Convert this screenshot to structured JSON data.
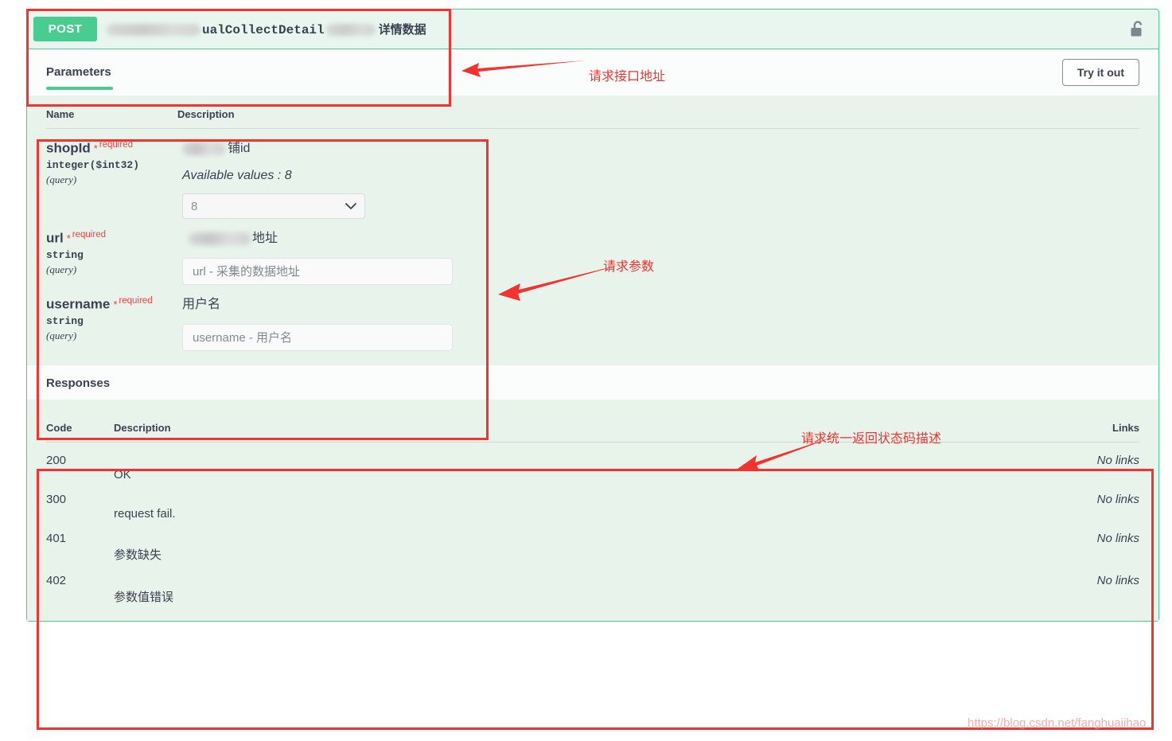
{
  "operation": {
    "method": "POST",
    "path_suffix": "ualCollectDetail",
    "summary_cn": "详情数据",
    "lock_icon": "unlocked-padlock-icon"
  },
  "tabs": {
    "parameters_label": "Parameters",
    "try_it_out_label": "Try it out"
  },
  "parameters_table": {
    "header": {
      "name": "Name",
      "description": "Description"
    },
    "rows": [
      {
        "name": "shopId",
        "required_star": "*",
        "required_word": "required",
        "type": "integer($int32)",
        "in": "(query)",
        "description_cn": "铺id",
        "available_values_label": "Available values",
        "available_values": "8",
        "control": "select",
        "select_value": "8",
        "chevron": "chevron-down-icon"
      },
      {
        "name": "url",
        "required_star": "*",
        "required_word": "required",
        "type": "string",
        "in": "(query)",
        "description_cn": "地址",
        "control": "input",
        "placeholder": "url - 采集的数据地址",
        "value": ""
      },
      {
        "name": "username",
        "required_star": "*",
        "required_word": "required",
        "type": "string",
        "in": "(query)",
        "description_cn": "用户名",
        "control": "input",
        "placeholder": "username - 用户名",
        "value": ""
      }
    ]
  },
  "responses": {
    "title": "Responses",
    "header": {
      "code": "Code",
      "description": "Description",
      "links": "Links"
    },
    "rows": [
      {
        "code": "200",
        "description": "OK",
        "links": "No links"
      },
      {
        "code": "300",
        "description": "request fail.",
        "links": "No links"
      },
      {
        "code": "401",
        "description": "参数缺失",
        "links": "No links"
      },
      {
        "code": "402",
        "description": "参数值错误",
        "links": "No links"
      }
    ]
  },
  "annotations": {
    "endpoint": "请求接口地址",
    "parameters": "请求参数",
    "responses": "请求统一返回状态码描述",
    "box_color": "#f5332e"
  },
  "watermark": "https://blog.csdn.net/fanghuaiihao",
  "colors": {
    "method_green": "#49cc90",
    "panel_mint": "#e8f3ec",
    "annotation_red": "#f5332e"
  }
}
